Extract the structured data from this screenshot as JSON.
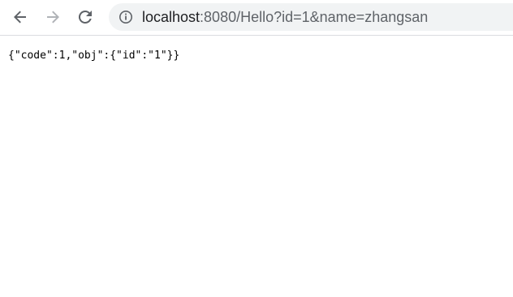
{
  "browser": {
    "url_host": "localhost",
    "url_rest": ":8080/Hello?id=1&name=zhangsan",
    "icons": {
      "back": "arrow-left-icon",
      "forward": "arrow-right-icon",
      "reload": "reload-icon",
      "site_info": "info-circle-icon"
    }
  },
  "page": {
    "body_text": "{\"code\":1,\"obj\":{\"id\":\"1\"}}"
  },
  "colors": {
    "omnibox_bg": "#f1f3f4",
    "icon": "#5f6368",
    "icon_disabled": "#b0b3b7"
  }
}
